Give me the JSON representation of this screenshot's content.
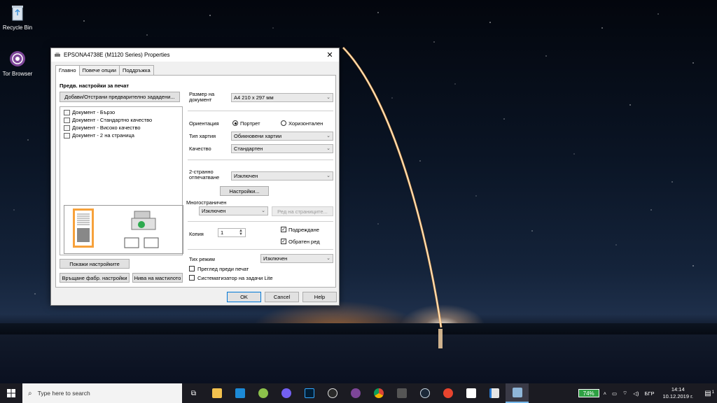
{
  "desktop": {
    "icons": [
      {
        "label": "Recycle Bin"
      },
      {
        "label": "Tor Browser"
      }
    ]
  },
  "dialog": {
    "title": "EPSONA4738E (M1120 Series) Properties",
    "tabs": [
      "Главно",
      "Повече опции",
      "Поддръжка"
    ],
    "presets_heading": "Предв. настройки за печат",
    "add_remove_presets": "Добави/Отстрани предварително зададени...",
    "presets": [
      "Документ - Бързо",
      "Документ - Стандартно качество",
      "Документ - Високо качество",
      "Документ - 2 на страница"
    ],
    "show_settings": "Покажи настройките",
    "restore_defaults": "Връщане фабр. настройки",
    "ink_levels": "Нива на мастилото",
    "paper_size_label": "Размер на документ",
    "paper_size_value": "A4 210 x 297 мм",
    "orientation_label": "Ориентация",
    "portrait": "Портрет",
    "landscape": "Хоризонтален",
    "paper_type_label": "Тип хартия",
    "paper_type_value": "Обикновени хартии",
    "quality_label": "Качество",
    "quality_value": "Стандартен",
    "duplex_label": "2-странно отпечатване",
    "duplex_value": "Изключен",
    "duplex_settings": "Настройки...",
    "multipage_label": "Многостраничен",
    "multipage_value": "Изключен",
    "page_order": "Ред на страниците...",
    "copies_label": "Копия",
    "copies_value": "1",
    "collate": "Подреждане",
    "reverse_order": "Обратен ред",
    "quiet_label": "Тих режим",
    "quiet_value": "Изключен",
    "preview": "Преглед преди печат",
    "job_arranger": "Систематизатор на задачи Lite",
    "ok": "OK",
    "cancel": "Cancel",
    "help": "Help"
  },
  "taskbar": {
    "search_placeholder": "Type here to search",
    "battery": "74%",
    "language": "БГР",
    "time": "14:14",
    "date": "10.12.2019 г.",
    "notification_count": "1"
  }
}
